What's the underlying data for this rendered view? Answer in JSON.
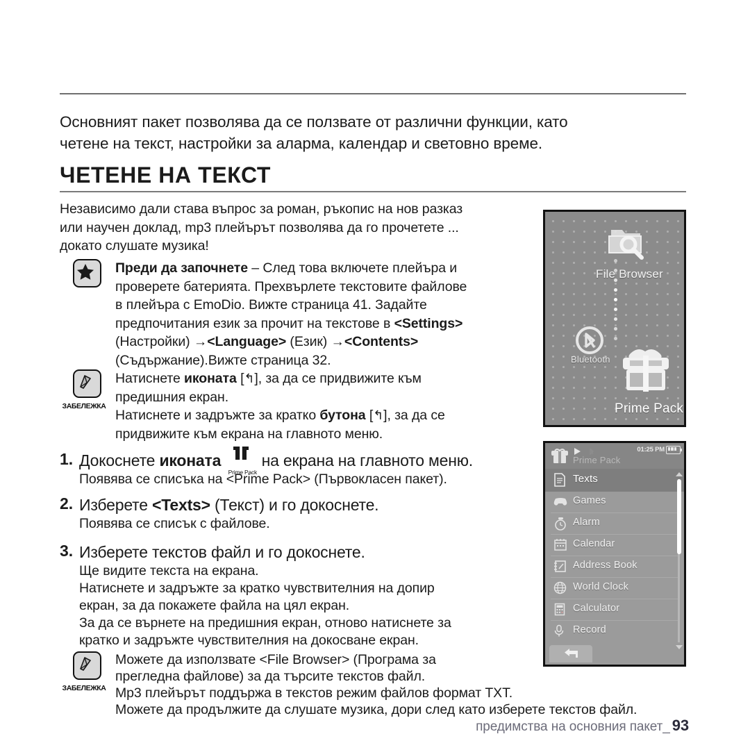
{
  "intro": {
    "line1": "Основният пакет позволява да се ползвате от различни функции, като",
    "line2": "четене на текст, настройки за аларма, календар и световно време."
  },
  "section": {
    "heading": "ЧЕТЕНЕ НА ТЕКСТ"
  },
  "lead": {
    "line1": "Независимо дали става въпрос за роман, ръкопис на нов разказ",
    "line2": "или научен доклад, mp3 плейърът позволява да го прочетете ...",
    "line3": "докато слушате музика!"
  },
  "note_star": {
    "icon": "star-icon",
    "title": "Преди да започнете",
    "dash": " – ",
    "t1": "След това включете плейъра и",
    "t2": "проверете батерията. Прехвърлете текстовите файлове",
    "t3": "в плейъра с EmoDio. Вижте страница 41. Задайте",
    "t4a": "предпочитания език за прочит на текстове в ",
    "t4b": "<Settings>",
    "t5a": "(Настройки) ",
    "t5arrow": "→",
    "t5b": "<Language>",
    "t5c": " (Език) ",
    "t5arrow2": "→",
    "t5d": "<Contents>",
    "t6": "(Съдържание).Вижте страница 32."
  },
  "note_top": {
    "icon": "note-pencil-icon",
    "caption": "ЗАБЕЛЕЖКА",
    "l1a": "Натиснете ",
    "l1b": "иконата",
    "l1c": " [",
    "l1glyph": "↰",
    "l1d": "], за да се придвижите към",
    "l2": "предишния екран.",
    "l3a": "Натиснете и задръжте за кратко ",
    "l3b": "бутона",
    "l3c": " [",
    "l3glyph": "↰",
    "l3d": "], за да се",
    "l4": "придвижите към екрана на главното меню."
  },
  "steps": [
    {
      "num": "1.",
      "main_a": "Докоснете ",
      "main_b": "иконата",
      "icon": "gift-icon",
      "icon_caption": "Prime Pack",
      "main_c": " на екрана на главното меню.",
      "sub": "Появява се списъка на <Prime Pack> (Първокласен пакет)."
    },
    {
      "num": "2.",
      "main_a": "Изберете ",
      "main_b": "<Texts>",
      "main_c": " (Текст) и го докоснете.",
      "sub": "Появява се списък с файлове."
    },
    {
      "num": "3.",
      "main_a": "Изберете текстов файл и го докоснете.",
      "sub1": "Ще видите текста на екрана.",
      "sub2": "Натиснете и задръжте за кратко чувствителния на допир",
      "sub3": "екран, за да покажете файла на цял екран.",
      "sub4": "За да се върнете на предишния екран, отново натиснете за",
      "sub5": "кратко и задръжте чувствителния на докосване екран."
    }
  ],
  "note_bottom": {
    "icon": "note-pencil-icon",
    "caption": "ЗАБЕЛЕЖКА",
    "l1": "Можете да използвате <File Browser> (Програма за",
    "l2": "прегледна файлове) за да търсите текстов файл.",
    "l3": "Mp3 плейърът поддържа в текстов режим файлов формат TXT.",
    "l4": "Можете да продължите да слушате музика, дори след като изберете текстов файл."
  },
  "menu_screen": {
    "file_browser_label": "File Browser",
    "bluetooth_label": "Bluetooth",
    "prime_pack_label": "Prime Pack"
  },
  "list_screen": {
    "status_time": "01:25 PM",
    "title": "Prime Pack",
    "items": [
      {
        "label": "Texts",
        "icon": "document-icon",
        "selected": true
      },
      {
        "label": "Games",
        "icon": "gamepad-icon",
        "selected": false
      },
      {
        "label": "Alarm",
        "icon": "alarm-clock-icon",
        "selected": false
      },
      {
        "label": "Calendar",
        "icon": "calendar-icon",
        "selected": false
      },
      {
        "label": "Address Book",
        "icon": "address-book-icon",
        "selected": false
      },
      {
        "label": "World Clock",
        "icon": "globe-icon",
        "selected": false
      },
      {
        "label": "Calculator",
        "icon": "calculator-icon",
        "selected": false
      },
      {
        "label": "Record",
        "icon": "microphone-icon",
        "selected": false
      }
    ],
    "back_button_icon": "back-arrow-icon"
  },
  "footer": {
    "text": "предимства на основния пакет_",
    "page": "93"
  },
  "colors": {
    "rule": "#6f6f6f",
    "screen_bg": "#8b8b8b",
    "list_bg": "#9b9b9b",
    "selected_row": "#7e7e7e",
    "footer_text": "#6c6c7a"
  }
}
